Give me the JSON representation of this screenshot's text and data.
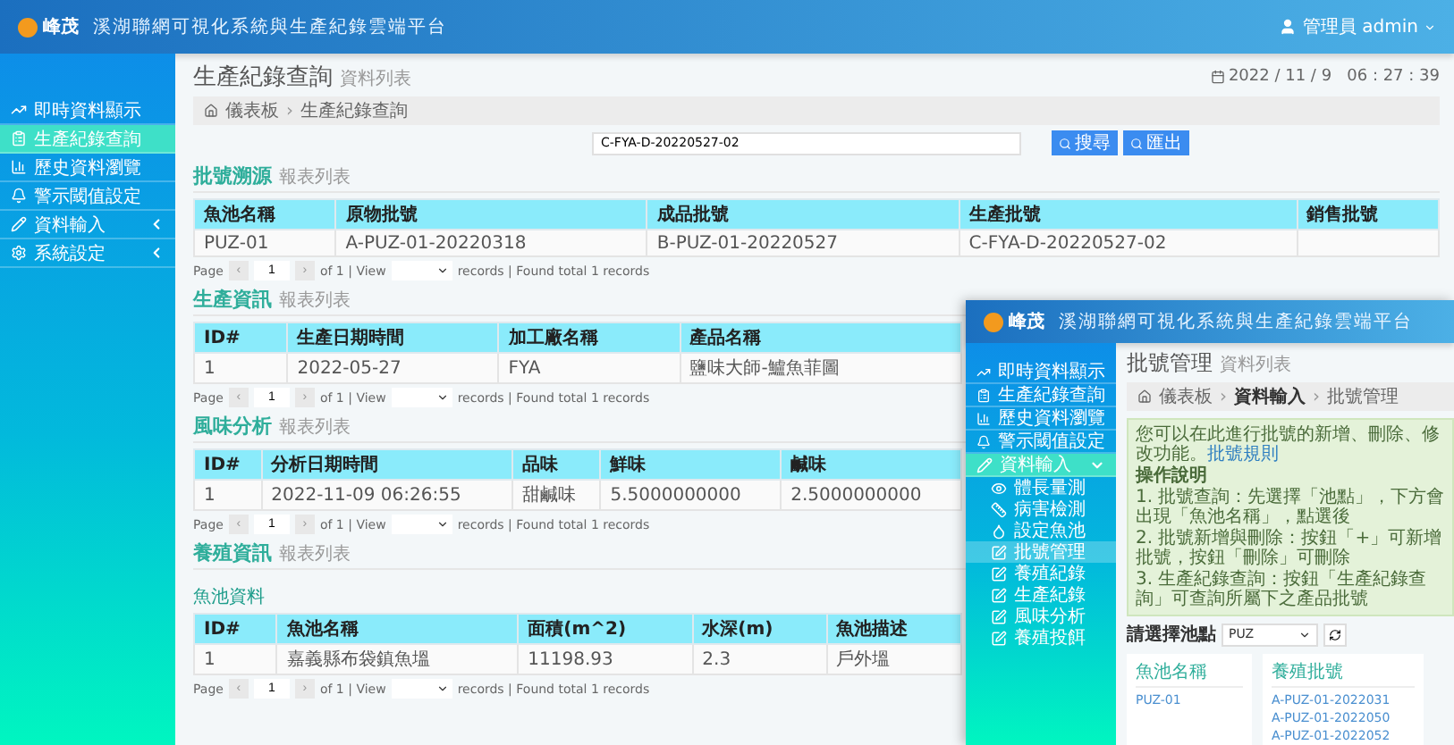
{
  "header": {
    "logo_text": "峰茂",
    "title": "溪湖聯網可視化系統與生產紀錄雲端平台",
    "user": "管理員 admin"
  },
  "sidebar": {
    "items": [
      {
        "label": "即時資料顯示",
        "selected": false
      },
      {
        "label": "生產紀錄查詢",
        "selected": true
      },
      {
        "label": "歷史資料瀏覽",
        "selected": false
      },
      {
        "label": "警示閾值設定",
        "selected": false
      },
      {
        "label": "資料輸入",
        "selected": false,
        "expanded": false
      },
      {
        "label": "系統設定",
        "selected": false,
        "expanded": false
      }
    ]
  },
  "page": {
    "title": "生產紀錄查詢",
    "subtitle": "資料列表",
    "datetime": "2022 / 11 / 9   06 : 27 : 39",
    "breadcrumb": [
      {
        "kind": "link",
        "text": "儀表板"
      },
      {
        "kind": "separator",
        "text": "›"
      },
      {
        "kind": "link",
        "text": "生產紀錄查詢"
      }
    ],
    "search": {
      "value": "C-FYA-D-20220527-02",
      "buttons": [
        "搜尋",
        "匯出"
      ]
    }
  },
  "sections": [
    {
      "title": "批號溯源",
      "subtitle": "報表列表",
      "columns": [
        "魚池名稱",
        "原物批號",
        "成品批號",
        "生產批號",
        "銷售批號"
      ],
      "rows": [
        [
          "PUZ-01",
          "A-PUZ-01-20220318",
          "B-PUZ-01-20220527",
          "C-FYA-D-20220527-02",
          ""
        ]
      ],
      "pager": {
        "label": "Page",
        "prev": "‹",
        "page": "1",
        "next": "›",
        "of": "of 1 | View",
        "records": "records | Found total 1 records"
      }
    },
    {
      "title": "生產資訊",
      "subtitle": "報表列表",
      "columns": [
        "ID#",
        "生產日期時間",
        "加工廠名稱",
        "產品名稱"
      ],
      "rows": [
        [
          "1",
          "2022-05-27",
          "FYA",
          "鹽味大師-鱸魚菲圖"
        ]
      ],
      "pager": {
        "label": "Page",
        "prev": "‹",
        "page": "1",
        "next": "›",
        "of": "of 1 | View",
        "records": "records | Found total 1 records"
      }
    },
    {
      "title": "風味分析",
      "subtitle": "報表列表",
      "columns": [
        "ID#",
        "分析日期時間",
        "品味",
        "鮮味",
        "鹹味"
      ],
      "rows": [
        [
          "1",
          "2022-11-09 06:26:55",
          "甜鹹味",
          "5.5000000000",
          "2.5000000000"
        ]
      ],
      "pager": {
        "label": "Page",
        "prev": "‹",
        "page": "1",
        "next": "›",
        "of": "of 1 | View",
        "records": "records | Found total 1 records"
      }
    },
    {
      "title": "養殖資訊",
      "subtitle": "報表列表",
      "link": "魚池資料",
      "columns": [
        "ID#",
        "魚池名稱",
        "面積(m^2)",
        "水深(m)",
        "魚池描述"
      ],
      "rows": [
        [
          "1",
          "嘉義縣布袋鎮魚塭",
          "11198.93",
          "2.3",
          "戶外塭"
        ]
      ],
      "pager": {
        "label": "Page",
        "prev": "‹",
        "page": "1",
        "next": "›",
        "of": "of 1 | View",
        "records": "records | Found total 1 records"
      }
    }
  ],
  "second_window": {
    "header": {
      "logo_text": "峰茂",
      "title": "溪湖聯網可視化系統與生產紀錄雲端平台"
    },
    "sidebar": {
      "items": [
        {
          "label": "即時資料顯示",
          "selected": false
        },
        {
          "label": "生產紀錄查詢",
          "selected": false
        },
        {
          "label": "歷史資料瀏覽",
          "selected": false
        },
        {
          "label": "警示閾值設定",
          "selected": false
        },
        {
          "label": "資料輸入",
          "selected": true,
          "expanded": true,
          "children": [
            {
              "label": "體長量測",
              "selected": false
            },
            {
              "label": "病害檢測",
              "selected": false
            },
            {
              "label": "設定魚池",
              "selected": false
            },
            {
              "label": "批號管理",
              "selected": true
            },
            {
              "label": "養殖紀錄",
              "selected": false
            },
            {
              "label": "生產紀錄",
              "selected": false
            },
            {
              "label": "風味分析",
              "selected": false
            },
            {
              "label": "養殖投餌",
              "selected": false
            }
          ]
        }
      ]
    },
    "page": {
      "title": "批號管理",
      "subtitle": "資料列表",
      "breadcrumb": [
        {
          "kind": "link",
          "text": "儀表板"
        },
        {
          "kind": "separator",
          "text": "›"
        },
        {
          "kind": "current",
          "text": "資料輸入"
        },
        {
          "kind": "separator",
          "text": "›"
        },
        {
          "kind": "link",
          "text": "批號管理"
        }
      ],
      "alert": {
        "intro": "您可以在此進行批號的新增、刪除、修改功能。",
        "link": "批號規則",
        "heading": "操作說明",
        "lines": [
          "1. 批號查詢：先選擇「池點」，下方會出現「魚池名稱」，點選後",
          "2. 批號新增與刪除：按鈕「+」可新增批號，按鈕「刪除」可刪除",
          "3. 生產紀錄查詢：按鈕「生產紀錄查詢」可查詢所屬下之產品批號"
        ]
      },
      "select_label": "請選擇池點",
      "select_value": "PUZ",
      "cards": [
        {
          "header": "魚池名稱",
          "items": [
            "PUZ-01"
          ]
        },
        {
          "header": "養殖批號",
          "items": [
            "A-PUZ-01-2022031",
            "A-PUZ-01-2022050",
            "A-PUZ-01-2022052"
          ]
        }
      ]
    }
  }
}
